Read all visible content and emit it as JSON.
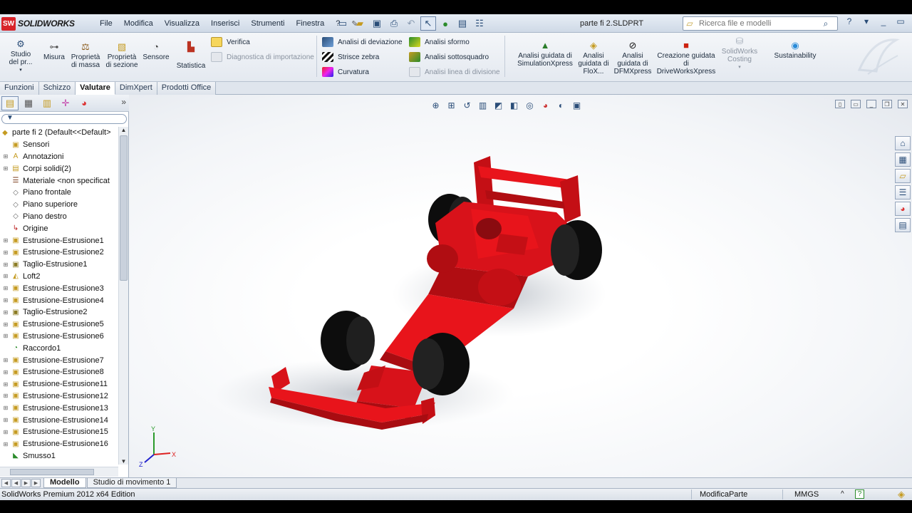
{
  "app": {
    "logo_box": "SW",
    "logo_text": "SOLIDWORKS",
    "document_title": "parte fi 2.SLDPRT"
  },
  "menu": [
    "File",
    "Modifica",
    "Visualizza",
    "Inserisci",
    "Strumenti",
    "Finestra",
    "?"
  ],
  "search": {
    "placeholder": "Ricerca file e modelli"
  },
  "ribbon": {
    "studio": "Studio del pr...",
    "misura": "Misura",
    "proprieta_massa": "Proprietà di massa",
    "proprieta_sezione": "Proprietà di sezione",
    "sensore": "Sensore",
    "statistica": "Statistica",
    "verifica": "Verifica",
    "diagnostica": "Diagnostica di importazione",
    "analisi_deviazione": "Analisi di deviazione",
    "strisce_zebra": "Strisce zebra",
    "curvatura": "Curvatura",
    "analisi_sformo": "Analisi sformo",
    "analisi_sottosquadro": "Analisi sottosquadro",
    "analisi_linea_divisione": "Analisi linea di divisione",
    "simulationxpress": "Analisi guidata di SimulationXpress",
    "floxpress": "Analisi guidata di FloX...",
    "dfmxpress": "Analisi guidata di DFMXpress",
    "driveworks": "Creazione guidata di DriveWorksXpress",
    "costing": "SolidWorks Costing",
    "sustainability": "Sustainability"
  },
  "command_tabs": [
    "Funzioni",
    "Schizzo",
    "Valutare",
    "DimXpert",
    "Prodotti Office"
  ],
  "active_command_tab": "Valutare",
  "tree": {
    "root": "parte fi 2  (Default<<Default>",
    "items": [
      {
        "label": "Sensori",
        "icon": "sensor-folder-icon",
        "expandable": false
      },
      {
        "label": "Annotazioni",
        "icon": "annotation-icon",
        "expandable": true
      },
      {
        "label": "Corpi solidi(2)",
        "icon": "solid-bodies-folder-icon",
        "expandable": true
      },
      {
        "label": "Materiale <non specificat",
        "icon": "material-icon",
        "expandable": false
      },
      {
        "label": "Piano frontale",
        "icon": "plane-icon",
        "expandable": false
      },
      {
        "label": "Piano superiore",
        "icon": "plane-icon",
        "expandable": false
      },
      {
        "label": "Piano destro",
        "icon": "plane-icon",
        "expandable": false
      },
      {
        "label": "Origine",
        "icon": "origin-icon",
        "expandable": false
      },
      {
        "label": "Estrusione-Estrusione1",
        "icon": "extrude-icon",
        "expandable": true
      },
      {
        "label": "Estrusione-Estrusione2",
        "icon": "extrude-icon",
        "expandable": true
      },
      {
        "label": "Taglio-Estrusione1",
        "icon": "cut-extrude-icon",
        "expandable": true
      },
      {
        "label": "Loft2",
        "icon": "loft-icon",
        "expandable": true
      },
      {
        "label": "Estrusione-Estrusione3",
        "icon": "extrude-icon",
        "expandable": true
      },
      {
        "label": "Estrusione-Estrusione4",
        "icon": "extrude-icon",
        "expandable": true
      },
      {
        "label": "Taglio-Estrusione2",
        "icon": "cut-extrude-icon",
        "expandable": true
      },
      {
        "label": "Estrusione-Estrusione5",
        "icon": "extrude-icon",
        "expandable": true
      },
      {
        "label": "Estrusione-Estrusione6",
        "icon": "extrude-icon",
        "expandable": true
      },
      {
        "label": "Raccordo1",
        "icon": "fillet-icon",
        "expandable": false
      },
      {
        "label": "Estrusione-Estrusione7",
        "icon": "extrude-icon",
        "expandable": true
      },
      {
        "label": "Estrusione-Estrusione8",
        "icon": "extrude-icon",
        "expandable": true
      },
      {
        "label": "Estrusione-Estrusione11",
        "icon": "extrude-icon",
        "expandable": true
      },
      {
        "label": "Estrusione-Estrusione12",
        "icon": "extrude-icon",
        "expandable": true
      },
      {
        "label": "Estrusione-Estrusione13",
        "icon": "extrude-icon",
        "expandable": true
      },
      {
        "label": "Estrusione-Estrusione14",
        "icon": "extrude-icon",
        "expandable": true
      },
      {
        "label": "Estrusione-Estrusione15",
        "icon": "extrude-icon",
        "expandable": true
      },
      {
        "label": "Estrusione-Estrusione16",
        "icon": "extrude-icon",
        "expandable": true
      },
      {
        "label": "Smusso1",
        "icon": "chamfer-icon",
        "expandable": false
      }
    ]
  },
  "axes": {
    "y": "Y",
    "x": "X",
    "z": "Z"
  },
  "bottom_tabs": [
    "Modello",
    "Studio di movimento 1"
  ],
  "status": {
    "edition": "SolidWorks Premium 2012 x64 Edition",
    "mode": "ModificaParte",
    "units": "MMGS",
    "units_arrow": "^"
  },
  "colors": {
    "model_red": "#e8141b",
    "tire_black": "#0d0d0d",
    "accent_blue": "#2a4d78"
  }
}
